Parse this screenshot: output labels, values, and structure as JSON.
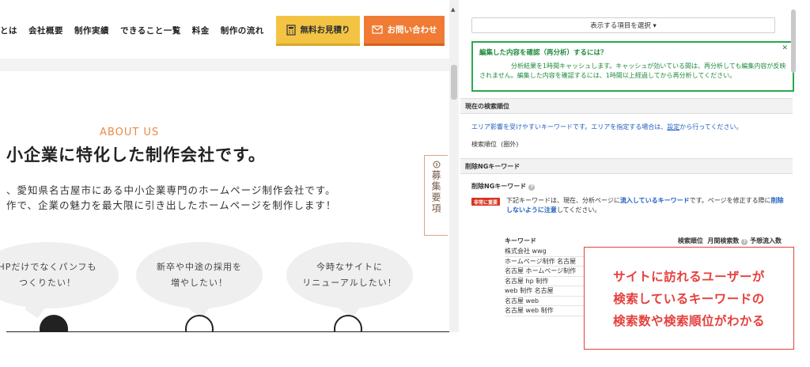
{
  "site": {
    "nav": [
      "とは",
      "会社概要",
      "制作実績",
      "できること一覧",
      "料金",
      "制作の流れ"
    ],
    "estimate_button": "無料お見積り",
    "contact_button": "お問い合わせ",
    "about_eyebrow": "ABOUT US",
    "about_title": "小企業に特化した制作会社です。",
    "about_lines": [
      "、愛知県名古屋市にある中小企業専門のホームページ制作会社です。",
      "作で、企業の魅力を最大限に引き出したホームページを制作します！"
    ],
    "recruit_tab": "募集要項",
    "bubbles": [
      {
        "line1": "HPだけでなくパンフも",
        "line2": "つくりたい！"
      },
      {
        "line1": "新卒や中途の採用を",
        "line2": "増やしたい！"
      },
      {
        "line1": "今時なサイトに",
        "line2": "リニューアルしたい！"
      }
    ]
  },
  "panel": {
    "select_label": "表示する項目を選択 ▾",
    "notice_title": "編集した内容を確認（再分析）するには？",
    "notice_body": "分析結果を1時間キャッシュします。キャッシュが効いている間は、再分析しても編集内容が反映されません。編集した内容を確認するには、1時間以上経過してから再分析してください。",
    "section_rank": "現在の検索順位",
    "area_note_pre": "エリア影響を受けやすいキーワードです。エリアを指定する場合は、",
    "area_note_link": "設定",
    "area_note_post": "から行ってください。",
    "rank_label": "検索順位",
    "rank_value": "(圏外)",
    "section_ng": "削除NGキーワード",
    "ng_title": "削除NGキーワード",
    "badge": "非常に重要",
    "ng_desc_pre": "下記キーワードは、現在、分析ページに",
    "ng_desc_hl1": "流入しているキーワード",
    "ng_desc_mid": "です。ページを修正する際に",
    "ng_desc_hl2": "削除しないように注意",
    "ng_desc_post": "してください。",
    "table_headers": {
      "keyword": "キーワード",
      "rank": "検索順位",
      "volume": "月間検索数",
      "inflow": "予想流入数"
    },
    "keywords": [
      "株式会社 wwg",
      "ホームページ制作 名古屋",
      "名古屋 ホームページ制作",
      "名古屋 hp 制作",
      "web 制作 名古屋",
      "名古屋 web",
      "名古屋 web 制作"
    ]
  },
  "callout": {
    "lines": [
      "サイトに訪れるユーザーが",
      "検索しているキーワードの",
      "検索数や検索順位がわかる"
    ]
  },
  "colors": {
    "accent_orange": "#f07b35",
    "accent_yellow": "#f3c443",
    "notice_green": "#2aa84e",
    "link_blue": "#1f5fbf",
    "callout_red": "#e4403d"
  }
}
